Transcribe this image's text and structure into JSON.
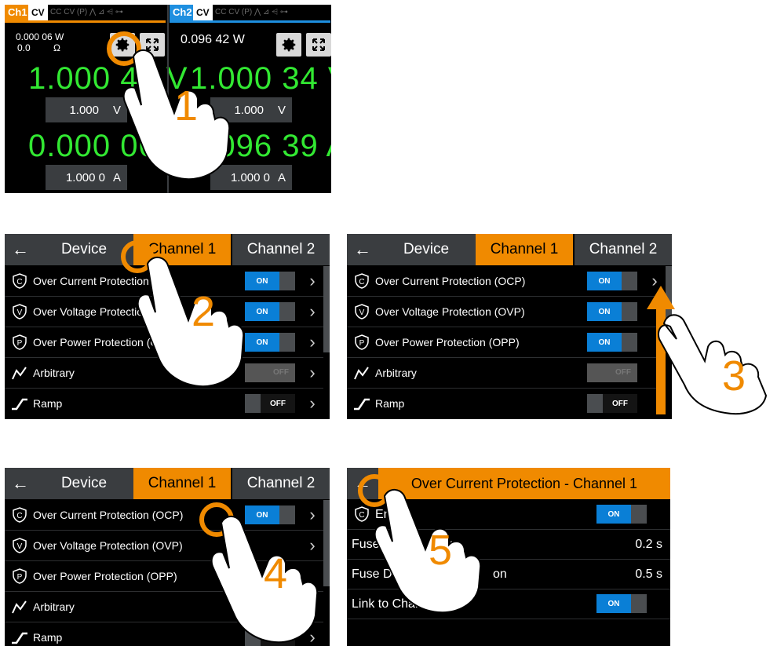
{
  "panel1": {
    "ch1": {
      "tag": "Ch1",
      "mode": "CV",
      "mode_indicators": "CC  CV  (P)  ⋀  ⊿  ⩤  ⊶",
      "power": "0.000 06 W",
      "resistance_value": "0.0",
      "resistance_unit": "Ω",
      "voltage": "1.000 46 V",
      "voltage_set": "1.000",
      "voltage_unit": "V",
      "current": "0.000 06 A",
      "current_set": "1.000 0",
      "current_unit": "A",
      "accent": "#f08a00"
    },
    "ch2": {
      "tag": "Ch2",
      "mode": "CV",
      "mode_indicators": "CC  CV  (P)  ⋀  ⊿  ⩤  ⊶",
      "power": "0.096 42 W",
      "voltage": "1.000 34 V",
      "voltage_set": "1.000",
      "voltage_unit": "V",
      "current": "0.096 39 A",
      "current_set": "1.000 0",
      "current_unit": "A",
      "accent": "#1e8fe0"
    }
  },
  "tabs": {
    "back": "←",
    "device": "Device",
    "channel1": "Channel 1",
    "channel2": "Channel 2"
  },
  "menu_items": [
    {
      "label": "Over Current Protection (OCP)",
      "icon": "ocp-shield-icon",
      "state": "ON"
    },
    {
      "label": "Over Voltage Protection (OVP)",
      "icon": "ovp-shield-icon",
      "state": "ON"
    },
    {
      "label": "Over Power Protection (OPP)",
      "icon": "opp-shield-icon",
      "state": "ON"
    },
    {
      "label": "Arbitrary",
      "icon": "arbitrary-icon",
      "state": "OFF"
    },
    {
      "label": "Ramp",
      "icon": "ramp-icon",
      "state": "OFF"
    }
  ],
  "panel2_labels": {
    "ocp": "Over Current Protection (",
    "ovp": "Over Voltage Protectio",
    "opp": "Over Power Protection (OPP)"
  },
  "panel5": {
    "title": "Over Current Protection - Channel 1",
    "enable_label": "En",
    "enable_state": "ON",
    "fuse_delay_label": "Fuse",
    "fuse_delay_mid": "v",
    "fuse_delay_value": "0.2 s",
    "fuse_delay_activation_label": "Fuse Delay A",
    "fuse_delay_activation_tail": "on",
    "fuse_delay_activation_value": "0.5 s",
    "link_label": "Link to Channel 2",
    "link_state": "ON"
  },
  "steps": [
    "1",
    "2",
    "3",
    "4",
    "5"
  ],
  "colors": {
    "orange": "#f08a00",
    "blue": "#0a7fd6",
    "green": "#32e832",
    "bar": "#3a3d40"
  }
}
